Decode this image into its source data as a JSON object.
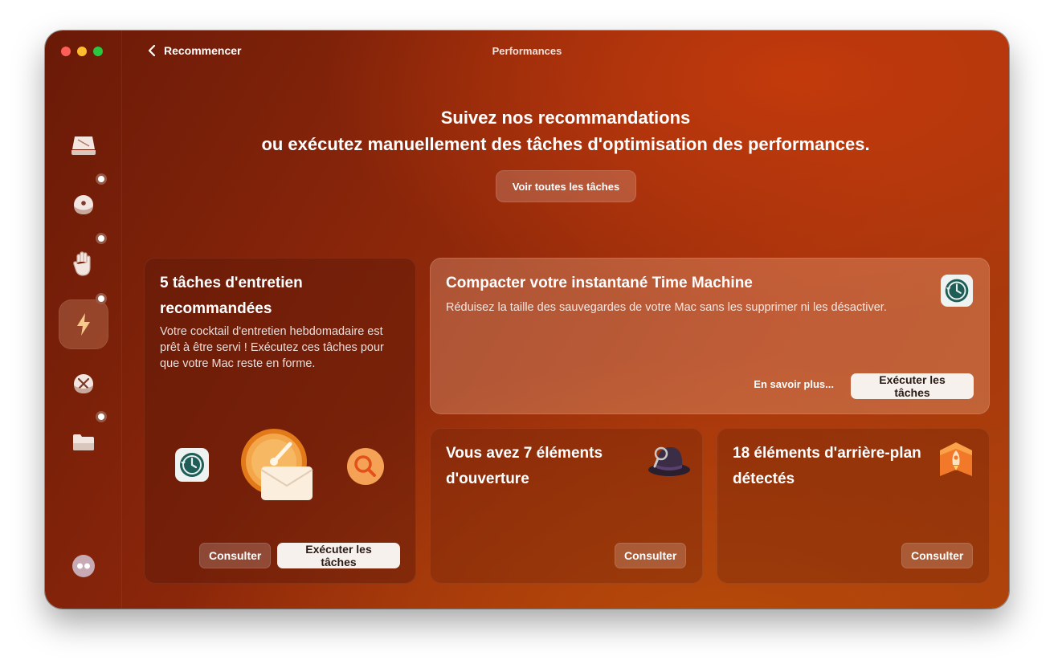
{
  "window": {
    "title": "Performances",
    "back_label": "Recommencer"
  },
  "headline": {
    "line1": "Suivez nos recommandations",
    "line2": "ou exécutez manuellement des tâches d'optimisation des performances."
  },
  "all_tasks_button": "Voir toutes les tâches",
  "sidebar": {
    "items": [
      {
        "icon": "laptop-drive-icon",
        "badge": false
      },
      {
        "icon": "shield-ball-icon",
        "badge": true
      },
      {
        "icon": "hand-stop-icon",
        "badge": true
      },
      {
        "icon": "lightning-icon",
        "badge": true,
        "active": true
      },
      {
        "icon": "tools-icon",
        "badge": false
      },
      {
        "icon": "folder-icon",
        "badge": true
      }
    ],
    "bottom_icon": "assistant-icon"
  },
  "cards": {
    "maintenance": {
      "title": "5 tâches d'entretien recommandées",
      "description": "Votre cocktail d'entretien hebdomadaire est prêt à être servi ! Exécutez ces tâches pour que votre Mac reste en forme.",
      "consult_label": "Consulter",
      "run_label": "Exécuter les tâches"
    },
    "time_machine": {
      "title": "Compacter votre instantané Time Machine",
      "description": "Réduisez la taille des sauvegardes de votre Mac sans les supprimer ni les désactiver.",
      "learn_more": "En savoir plus...",
      "run_label": "Exécuter les tâches"
    },
    "login_items": {
      "title": "Vous avez 7 éléments d'ouverture",
      "consult_label": "Consulter"
    },
    "background_items": {
      "title": "18 éléments d'arrière-plan détectés",
      "consult_label": "Consulter"
    }
  },
  "colors": {
    "accent_window": "#a8340c",
    "button_light": "#f7f1ee"
  }
}
